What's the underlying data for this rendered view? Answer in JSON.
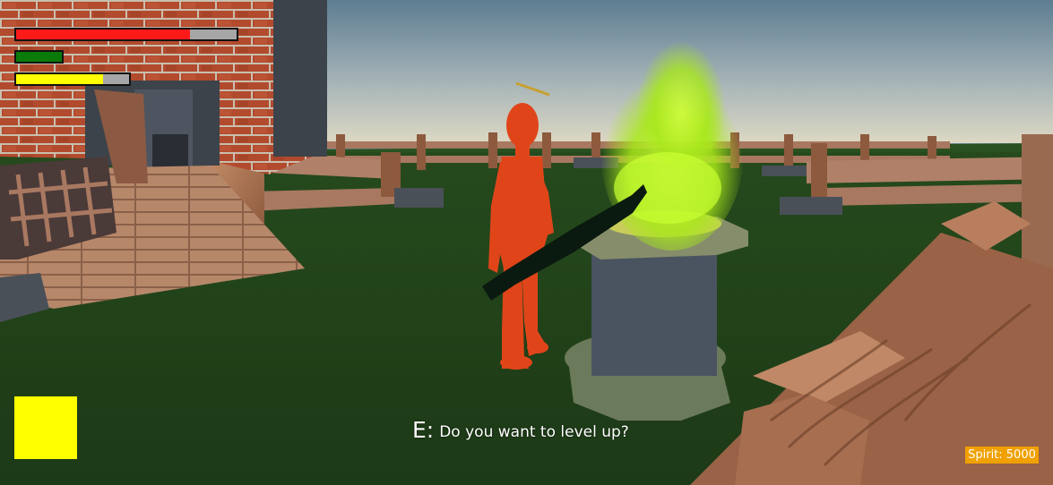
{
  "hud": {
    "health": {
      "level": 0.79,
      "color": "#ff1a1a"
    },
    "stamina": {
      "level": 1.0,
      "color": "#0a7a0a"
    },
    "energy": {
      "level": 0.77,
      "color": "#ffff00"
    },
    "ability_slot_color": "#ffff00"
  },
  "interaction": {
    "key": "E:",
    "message": "Do you want to level up?"
  },
  "currency": {
    "label": "Spirit: 5000"
  },
  "scene": {
    "flame_color": "#a8e81a",
    "character_color": "#e0451a",
    "ground_color": "#2e5a22"
  }
}
